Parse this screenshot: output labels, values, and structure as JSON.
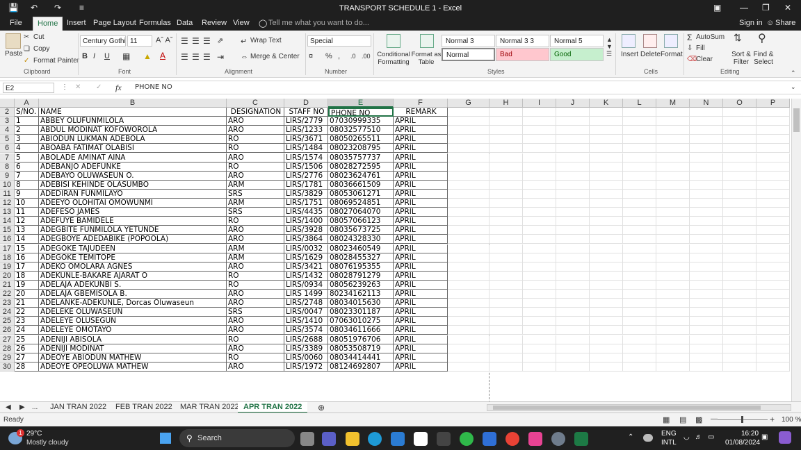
{
  "window": {
    "title": "TRANSPORT SCHEDULE 1 - Excel",
    "signin": "Sign in",
    "share": "Share"
  },
  "menu": [
    "File",
    "Home",
    "Insert",
    "Page Layout",
    "Formulas",
    "Data",
    "Review",
    "View"
  ],
  "tell_me": "Tell me what you want to do...",
  "ribbon": {
    "clipboard": {
      "paste": "Paste",
      "cut": "Cut",
      "copy": "Copy",
      "format_painter": "Format Painter",
      "label": "Clipboard"
    },
    "font": {
      "name": "Century Gothic",
      "size": "11",
      "label": "Font"
    },
    "alignment": {
      "wrap": "Wrap Text",
      "merge": "Merge & Center",
      "label": "Alignment"
    },
    "number": {
      "format": "Special",
      "label": "Number"
    },
    "styles": {
      "conditional": "Conditional Formatting",
      "format_as": "Format as Table",
      "s1": "Normal 3",
      "s2": "Normal 3 3",
      "s3": "Normal 5",
      "s4": "Normal",
      "s5": "Bad",
      "s6": "Good",
      "label": "Styles"
    },
    "cells": {
      "insert": "Insert",
      "delete": "Delete",
      "format": "Format",
      "label": "Cells"
    },
    "editing": {
      "autosum": "AutoSum",
      "fill": "Fill",
      "clear": "Clear",
      "sort": "Sort & Filter",
      "find": "Find & Select",
      "label": "Editing"
    }
  },
  "formula": {
    "namebox": "E2",
    "content": "PHONE NO"
  },
  "columns": [
    "A",
    "B",
    "C",
    "D",
    "E",
    "F",
    "G",
    "H",
    "I",
    "J",
    "K",
    "L",
    "M",
    "N",
    "O",
    "P"
  ],
  "header_row": {
    "row": "2",
    "a": "S/NO.",
    "b": "NAME",
    "c": "DESIGNATION",
    "d": "STAFF NO",
    "e": "PHONE NO",
    "f": "REMARK"
  },
  "rows": [
    [
      "3",
      "1",
      "ABBEY OLUFUNMILOLA",
      "ARO",
      "LIRS/2779",
      "07030999335",
      "APRIL"
    ],
    [
      "4",
      "2",
      "ABDUL MODINAT KOFOWOROLA",
      "ARO",
      "LIRS/1233",
      "08032577510",
      "APRIL"
    ],
    [
      "5",
      "3",
      "ABIODUN LUKMAN ADEBOLA",
      "RO",
      "LIRS/3671",
      "08050265511",
      "APRIL"
    ],
    [
      "6",
      "4",
      "ABOABA FATIMAT OLABISI",
      "RO",
      "LIRS/1484",
      "08023208795",
      "APRIL"
    ],
    [
      "7",
      "5",
      "ABOLADE AMINAT AINA",
      "ARO",
      "LIRS/1574",
      "08035757737",
      "APRIL"
    ],
    [
      "8",
      "6",
      "ADEBANJO ADEFUNKE",
      "RO",
      "LIRS/1506",
      "08028272595",
      "APRIL"
    ],
    [
      "9",
      "7",
      "ADEBAYO OLUWASEUN O.",
      "ARO",
      "LIRS/2776",
      "08023624761",
      "APRIL"
    ],
    [
      "10",
      "8",
      "ADEBISI KEHINDE OLASUMBO",
      "ARM",
      "LIRS/1781",
      "08036661509",
      "APRIL"
    ],
    [
      "11",
      "9",
      "ADEDIRAN FUNMILAYO",
      "SRS",
      "LIRS/3829",
      "08053061271",
      "APRIL"
    ],
    [
      "12",
      "10",
      "ADEEYO OLOHITAI OMOWUNMI",
      "ARM",
      "LIRS/1751",
      "08069524851",
      "APRIL"
    ],
    [
      "13",
      "11",
      "ADEFESO JAMES",
      "SRS",
      "LIRS/4435",
      "08027064070",
      "APRIL"
    ],
    [
      "14",
      "12",
      "ADEFUYE BAMIDELE",
      "RO",
      "LIRS/1400",
      "08057066123",
      "APRIL"
    ],
    [
      "15",
      "13",
      "ADEGBITE FUNMILOLA YETUNDE",
      "ARO",
      "LIRS/3928",
      "08035673725",
      "APRIL"
    ],
    [
      "16",
      "14",
      "ADEGBOYE ADEDABIKE (POPOOLA)",
      "ARO",
      "LIRS/3864",
      "08024328330",
      "APRIL"
    ],
    [
      "17",
      "15",
      "ADEGOKE TAJUDEEN",
      "ARM",
      "LIRS/0032",
      "08023460549",
      "APRIL"
    ],
    [
      "18",
      "16",
      "ADEGOKE TEMITOPE",
      "ARM",
      "LIRS/1629",
      "08028455327",
      "APRIL"
    ],
    [
      "19",
      "17",
      "ADEKO OMOLARA AGNES",
      "ARO",
      "LIRS/3421",
      "08076195355",
      "APRIL"
    ],
    [
      "20",
      "18",
      "ADEKUNLE-BAKARE AJARAT O",
      "RO",
      "LIRS/1432",
      "08028791279",
      "APRIL"
    ],
    [
      "21",
      "19",
      "ADELAJA ADEKUNBI S.",
      "RO",
      "LIRS/0934",
      "08056239263",
      "APRIL"
    ],
    [
      "22",
      "20",
      "ADELAJA GBEMISOLA B.",
      "ARO",
      "LIRS 1499",
      "80234162113",
      "APRIL"
    ],
    [
      "23",
      "21",
      "ADELANKE-ADEKUNLE, Dorcas Oluwaseun",
      "ARO",
      "LIRS/2748",
      "08034015630",
      "APRIL"
    ],
    [
      "24",
      "22",
      "ADELEKE OLUWASEUN",
      "SRS",
      "LIRS/0047",
      "08023301187",
      "APRIL"
    ],
    [
      "25",
      "23",
      "ADELEYE OLUSEGUN",
      "ARO",
      "LIRS/1410",
      "07063010275",
      "APRIL"
    ],
    [
      "26",
      "24",
      "ADELEYE OMOTAYO",
      "ARO",
      "LIRS/3574",
      "08034611666",
      "APRIL"
    ],
    [
      "27",
      "25",
      "ADENIJI ABISOLA",
      "RO",
      "LIRS/2688",
      "08051976706",
      "APRIL"
    ],
    [
      "28",
      "26",
      "ADENIJI MODINAT",
      "ARO",
      "LIRS/3389",
      "08053508719",
      "APRIL"
    ],
    [
      "29",
      "27",
      "ADEOYE ABIODUN MATHEW",
      "RO",
      "LIRS/0060",
      "08034414441",
      "APRIL"
    ],
    [
      "30",
      "28",
      "ADEOYE OPEOLUWA MATHEW",
      "ARO",
      "LIRS/1972",
      "08124692807",
      "APRIL"
    ]
  ],
  "sheets": [
    "JAN TRAN 2022",
    "FEB TRAN 2022",
    "MAR TRAN 2022",
    "APR TRAN 2022"
  ],
  "status": {
    "ready": "Ready",
    "zoom": "100 %"
  },
  "taskbar": {
    "temp": "29°C",
    "weather": "Mostly cloudy",
    "search": "Search",
    "lang1": "ENG",
    "lang2": "INTL",
    "time": "16:20",
    "date": "01/08/2024",
    "badge": "1"
  }
}
